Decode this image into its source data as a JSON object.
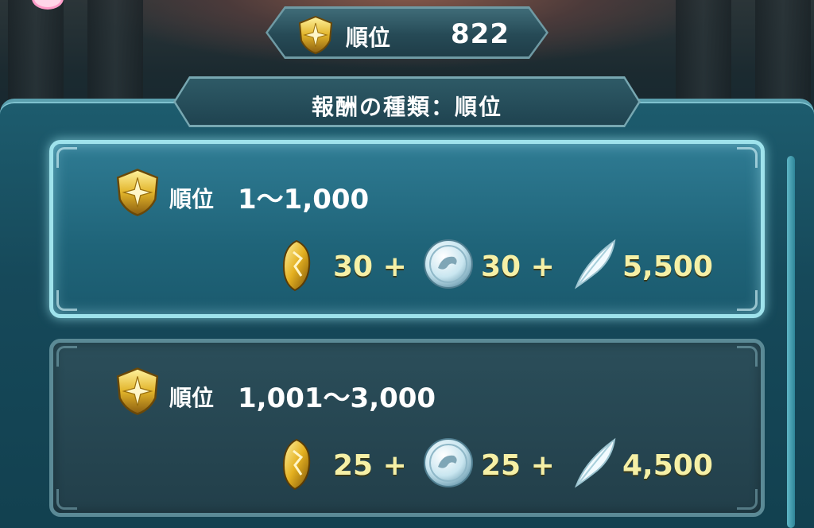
{
  "top_bar": {
    "rank_label": "順位",
    "rank_value": "822"
  },
  "header": {
    "title": "報酬の種類：順位"
  },
  "reward_tiers": [
    {
      "rank_label": "順位",
      "rank_range": "1～1,000",
      "selected": true,
      "rewards": {
        "orbs": "30 +",
        "crests": "30 +",
        "feathers": "5,500"
      }
    },
    {
      "rank_label": "順位",
      "rank_range": "1,001～3,000",
      "selected": false,
      "rewards": {
        "orbs": "25 +",
        "crests": "25 +",
        "feathers": "4,500"
      }
    }
  ],
  "icons": {
    "medal": "gold-shield-medal-icon",
    "orb": "gold-orb-icon",
    "crest": "silver-crest-coin-icon",
    "feather": "white-feather-icon"
  },
  "colors": {
    "reward_text": "#f6f0a6",
    "selected_border": "#9fe3ec",
    "panel_bg": "#1d5c6e"
  }
}
